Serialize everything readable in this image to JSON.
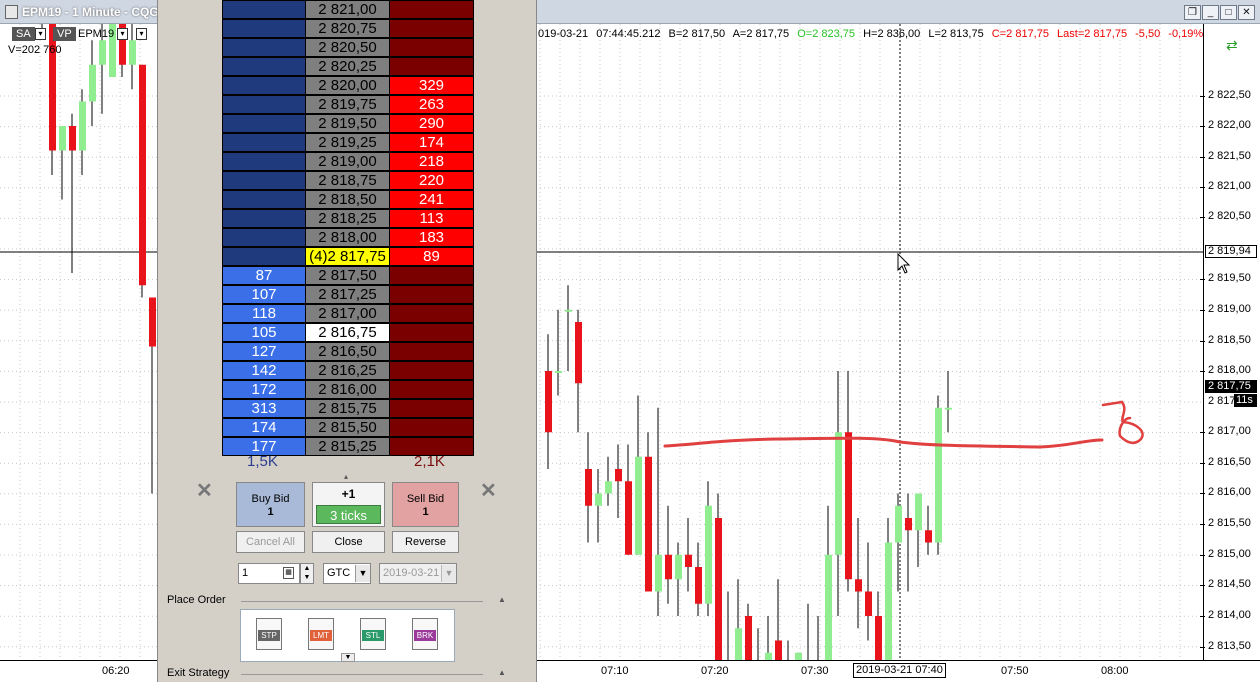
{
  "window": {
    "title": "EPM19 - 1 Minute - CQG"
  },
  "toolbar": {
    "sa": "SA",
    "vp": "VP",
    "symbol": "EPM19",
    "volume": "V=202 760"
  },
  "ohlc": {
    "date": "019-03-21",
    "time": "07:44:45.212",
    "bid": "B=2 817,50",
    "ask": "A=2 817,75",
    "open": "O=2 823,75",
    "high": "H=2 836,00",
    "low": "L=2 813,75",
    "close": "C=2 817,75",
    "last": "Last=2 817,75",
    "change": "-5,50",
    "pct": "-0,19%"
  },
  "price_axis": {
    "labels": [
      "2 822,50",
      "2 822,00",
      "2 821,50",
      "2 821,00",
      "2 820,50",
      "2 819,50",
      "2 819,00",
      "2 818,50",
      "2 818,00",
      "2 817,00",
      "2 816,50",
      "2 816,00",
      "2 815,50",
      "2 815,00",
      "2 814,50",
      "2 814,00",
      "2 813,50"
    ],
    "cursor_price": "2 819,94",
    "last_price": "2 817,75",
    "last_partial": "2 817",
    "timer": "11s"
  },
  "time_axis": {
    "labels": [
      "06:20",
      "07:10",
      "07:20",
      "07:30",
      "07:50",
      "08:00"
    ],
    "cursor_time": "2019-03-21 07:40"
  },
  "ladder": {
    "rows": [
      {
        "bid": "",
        "price": "2 821,00",
        "ask": ""
      },
      {
        "bid": "",
        "price": "2 820,75",
        "ask": ""
      },
      {
        "bid": "",
        "price": "2 820,50",
        "ask": ""
      },
      {
        "bid": "",
        "price": "2 820,25",
        "ask": ""
      },
      {
        "bid": "",
        "price": "2 820,00",
        "ask": "329"
      },
      {
        "bid": "",
        "price": "2 819,75",
        "ask": "263"
      },
      {
        "bid": "",
        "price": "2 819,50",
        "ask": "290"
      },
      {
        "bid": "",
        "price": "2 819,25",
        "ask": "174"
      },
      {
        "bid": "",
        "price": "2 819,00",
        "ask": "218"
      },
      {
        "bid": "",
        "price": "2 818,75",
        "ask": "220"
      },
      {
        "bid": "",
        "price": "2 818,50",
        "ask": "241"
      },
      {
        "bid": "",
        "price": "2 818,25",
        "ask": "113"
      },
      {
        "bid": "",
        "price": "2 818,00",
        "ask": "183"
      },
      {
        "bid": "",
        "price": "(4)2 817,75",
        "ask": "89"
      },
      {
        "bid": "87",
        "price": "2 817,50",
        "ask": ""
      },
      {
        "bid": "107",
        "price": "2 817,25",
        "ask": ""
      },
      {
        "bid": "118",
        "price": "2 817,00",
        "ask": ""
      },
      {
        "bid": "105",
        "price": "2 816,75",
        "ask": ""
      },
      {
        "bid": "127",
        "price": "2 816,50",
        "ask": ""
      },
      {
        "bid": "142",
        "price": "2 816,25",
        "ask": ""
      },
      {
        "bid": "172",
        "price": "2 816,00",
        "ask": ""
      },
      {
        "bid": "313",
        "price": "2 815,75",
        "ask": ""
      },
      {
        "bid": "174",
        "price": "2 815,50",
        "ask": ""
      },
      {
        "bid": "177",
        "price": "2 815,25",
        "ask": ""
      }
    ],
    "bid_total": "1,5K",
    "ask_total": "2,1K"
  },
  "controls": {
    "buy_label": "Buy Bid",
    "buy_qty": "1",
    "qty_plus": "+1",
    "ticks": "3 ticks",
    "sell_label": "Sell Bid",
    "sell_qty": "1",
    "cancel_all": "Cancel All",
    "close": "Close",
    "reverse": "Reverse",
    "quantity": "1",
    "tif": "GTC",
    "date": "2019-03-21",
    "place_order": "Place Order",
    "exit_strategy": "Exit Strategy",
    "order_types": [
      "STP",
      "LMT",
      "STL",
      "BRK"
    ]
  },
  "colors": {
    "bid_dark": "#1f3a7d",
    "bid_light": "#3a6fe8",
    "ask_red": "#ff0000",
    "ask_dark": "#7a0000",
    "up_candle": "#90ee90",
    "down_candle": "#e8131b"
  }
}
